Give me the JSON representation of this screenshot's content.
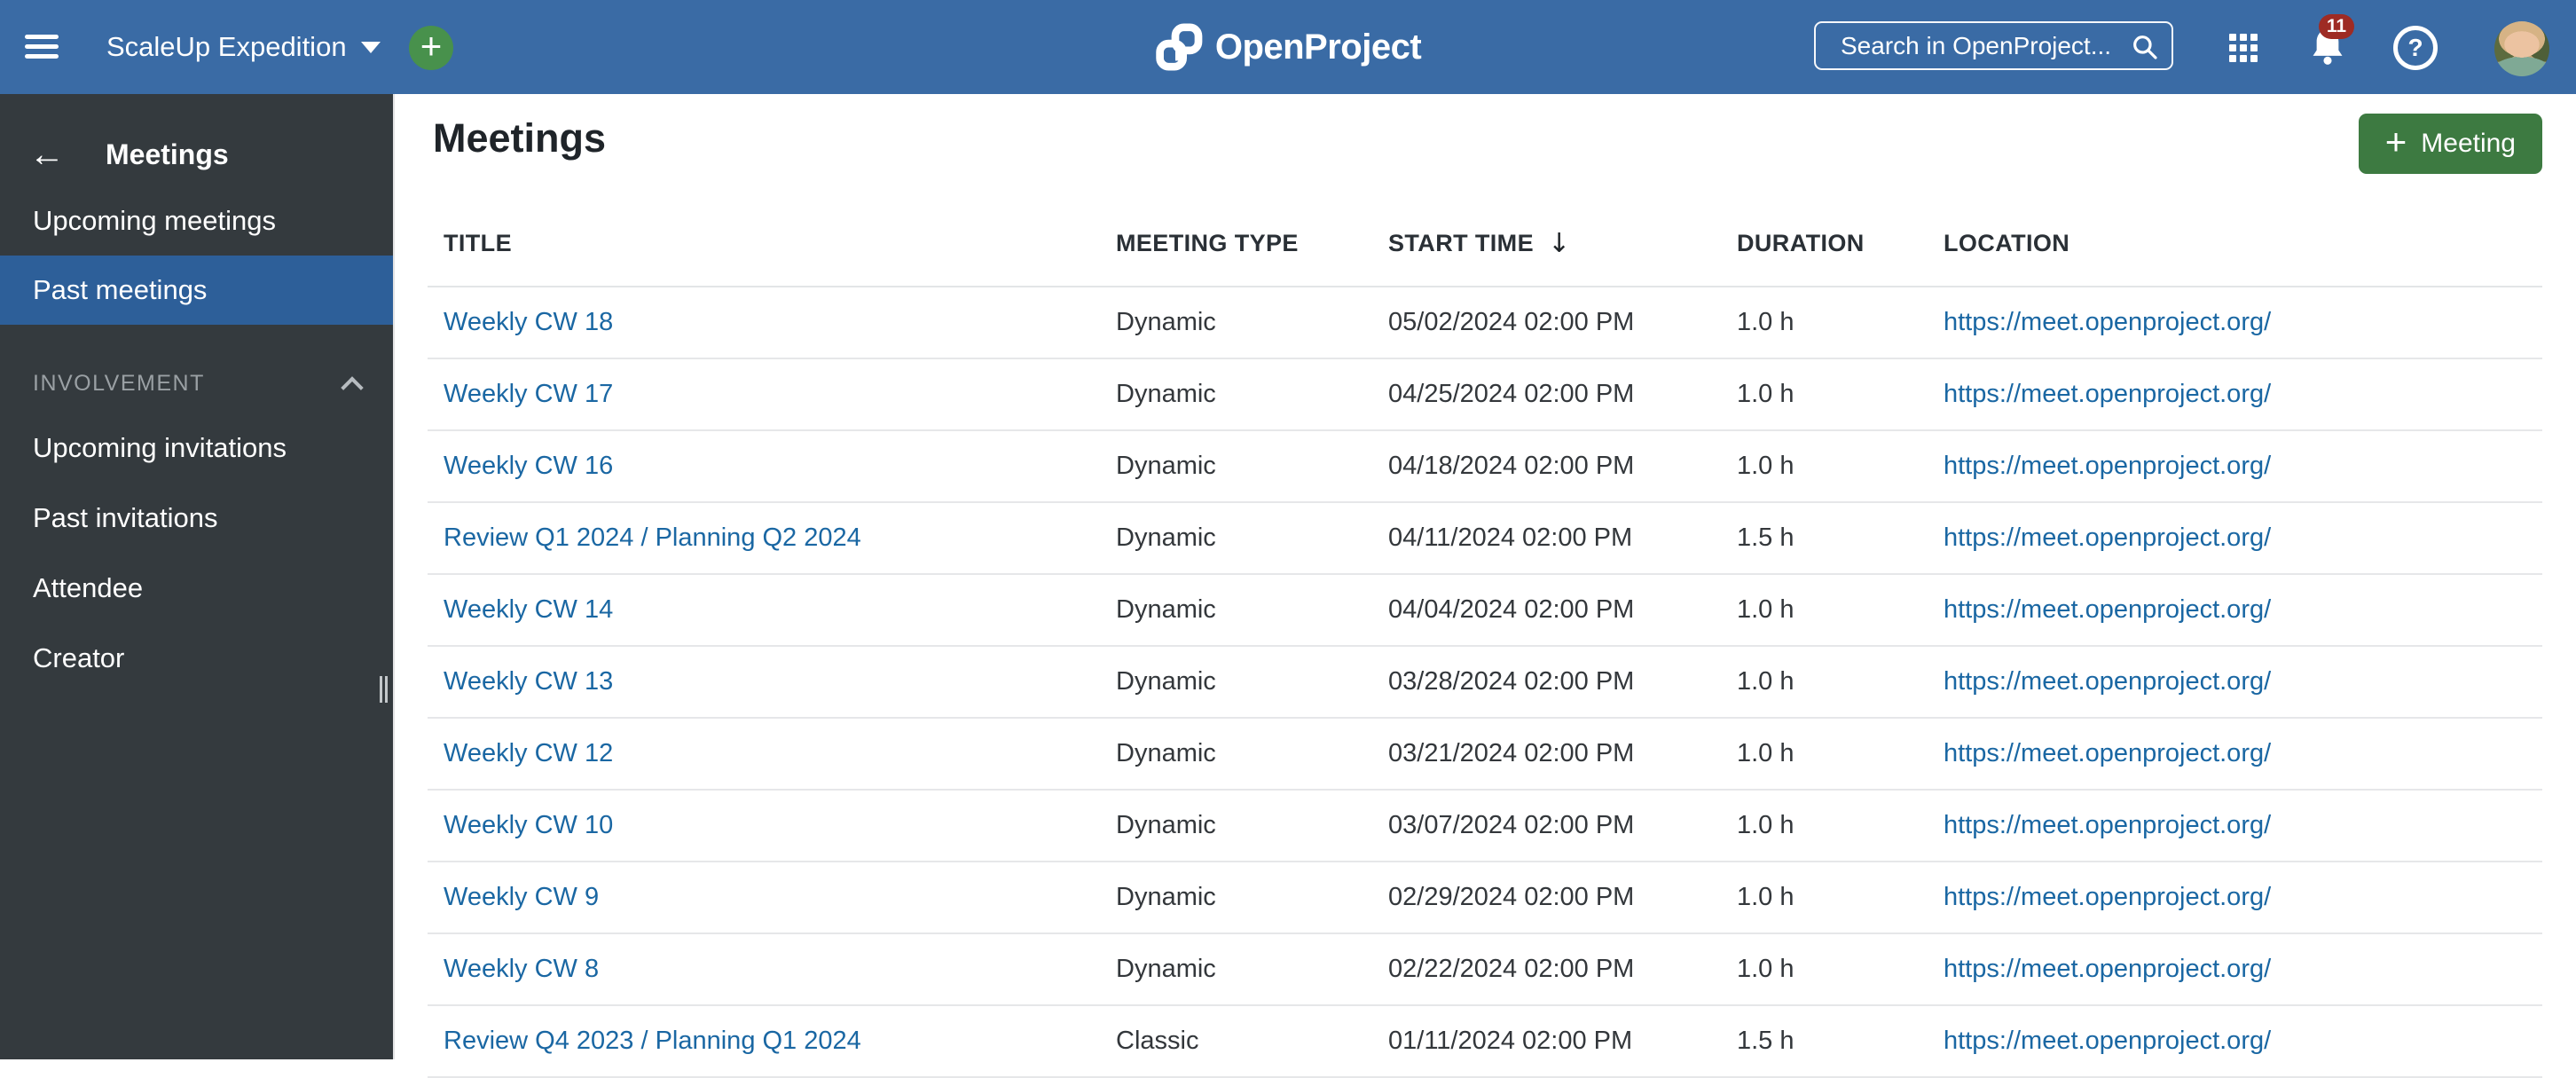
{
  "topbar": {
    "project_name": "ScaleUp Expedition",
    "logo_text": "OpenProject",
    "search_placeholder": "Search in OpenProject...",
    "notification_count": "11",
    "help_glyph": "?"
  },
  "sidebar": {
    "back_glyph": "←",
    "title": "Meetings",
    "items": [
      {
        "label": "Upcoming meetings",
        "selected": false
      },
      {
        "label": "Past meetings",
        "selected": true
      }
    ],
    "section_label": "INVOLVEMENT",
    "involvement_items": [
      {
        "label": "Upcoming invitations"
      },
      {
        "label": "Past invitations"
      },
      {
        "label": "Attendee"
      },
      {
        "label": "Creator"
      }
    ]
  },
  "main": {
    "title": "Meetings",
    "add_button_label": "Meeting",
    "add_button_plus": "+"
  },
  "table": {
    "columns": {
      "title": "TITLE",
      "type": "MEETING TYPE",
      "start": "START TIME",
      "duration": "DURATION",
      "location": "LOCATION"
    },
    "sort": {
      "column": "START TIME",
      "direction": "desc",
      "arrow_glyph": "↓"
    },
    "rows": [
      {
        "title": "Weekly CW 18",
        "type": "Dynamic",
        "start": "05/02/2024 02:00 PM",
        "duration": "1.0 h",
        "location": "https://meet.openproject.org/"
      },
      {
        "title": "Weekly CW 17",
        "type": "Dynamic",
        "start": "04/25/2024 02:00 PM",
        "duration": "1.0 h",
        "location": "https://meet.openproject.org/"
      },
      {
        "title": "Weekly CW 16",
        "type": "Dynamic",
        "start": "04/18/2024 02:00 PM",
        "duration": "1.0 h",
        "location": "https://meet.openproject.org/"
      },
      {
        "title": "Review Q1 2024 / Planning Q2 2024",
        "type": "Dynamic",
        "start": "04/11/2024 02:00 PM",
        "duration": "1.5 h",
        "location": "https://meet.openproject.org/"
      },
      {
        "title": "Weekly CW 14",
        "type": "Dynamic",
        "start": "04/04/2024 02:00 PM",
        "duration": "1.0 h",
        "location": "https://meet.openproject.org/"
      },
      {
        "title": "Weekly CW 13",
        "type": "Dynamic",
        "start": "03/28/2024 02:00 PM",
        "duration": "1.0 h",
        "location": "https://meet.openproject.org/"
      },
      {
        "title": "Weekly CW 12",
        "type": "Dynamic",
        "start": "03/21/2024 02:00 PM",
        "duration": "1.0 h",
        "location": "https://meet.openproject.org/"
      },
      {
        "title": "Weekly CW 10",
        "type": "Dynamic",
        "start": "03/07/2024 02:00 PM",
        "duration": "1.0 h",
        "location": "https://meet.openproject.org/"
      },
      {
        "title": "Weekly CW 9",
        "type": "Dynamic",
        "start": "02/29/2024 02:00 PM",
        "duration": "1.0 h",
        "location": "https://meet.openproject.org/"
      },
      {
        "title": "Weekly CW 8",
        "type": "Dynamic",
        "start": "02/22/2024 02:00 PM",
        "duration": "1.0 h",
        "location": "https://meet.openproject.org/"
      },
      {
        "title": "Review Q4 2023 / Planning Q1 2024",
        "type": "Classic",
        "start": "01/11/2024 02:00 PM",
        "duration": "1.5 h",
        "location": "https://meet.openproject.org/"
      }
    ]
  },
  "colors": {
    "topbar_bg": "#3a6ba5",
    "sidebar_bg": "#343a3e",
    "sidebar_selected_bg": "#2d5f99",
    "quick_add_green": "#48914c",
    "button_green": "#3d7a41",
    "badge_red": "#9e2b24",
    "link_blue": "#1a67a3",
    "divider_grey": "#e6e7e9"
  }
}
